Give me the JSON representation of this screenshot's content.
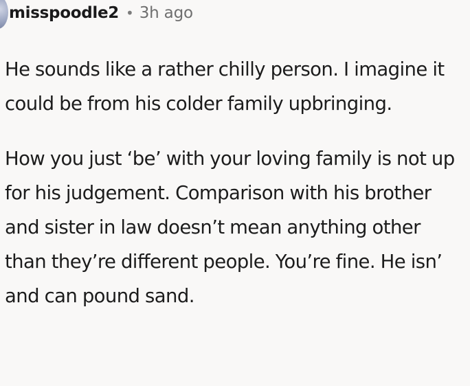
{
  "comment": {
    "author": "misspoodle2",
    "separator": "•",
    "timestamp": "3h ago",
    "paragraphs": [
      "He sounds like a rather chilly person. I imagine it could be from his colder family upbringing.",
      "How you just ‘be’ with your loving family is not up for his judgement. Comparison with his brother and sister in law doesn’t mean anything other than they’re different people. You’re fine. He isn’ and can pound sand."
    ]
  },
  "icons": {
    "avatar": "user-avatar-icon"
  },
  "colors": {
    "background": "#f9f8f7",
    "text": "#1a1a1b",
    "meta": "#6f6f6f"
  }
}
